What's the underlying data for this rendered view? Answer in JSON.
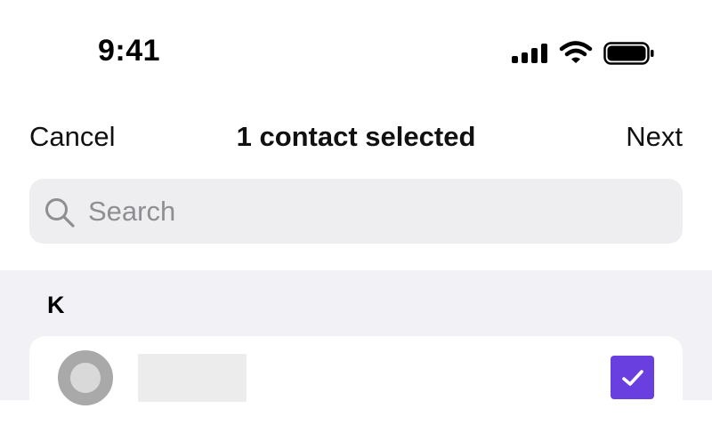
{
  "status_bar": {
    "time": "9:41",
    "icons": [
      "signal-icon",
      "wifi-icon",
      "battery-icon"
    ]
  },
  "nav": {
    "cancel_label": "Cancel",
    "title": "1 contact selected",
    "next_label": "Next"
  },
  "search": {
    "placeholder": "Search",
    "value": "",
    "icon": "search-icon"
  },
  "contacts": {
    "section_letter": "K",
    "rows": [
      {
        "selected": true,
        "avatar_icon": "avatar",
        "check_icon": "check-icon"
      }
    ]
  },
  "colors": {
    "accent": "#6a3fe0",
    "section_background": "#f2f2f6",
    "search_background": "#eeeef0",
    "placeholder_text": "#8e8e93"
  }
}
